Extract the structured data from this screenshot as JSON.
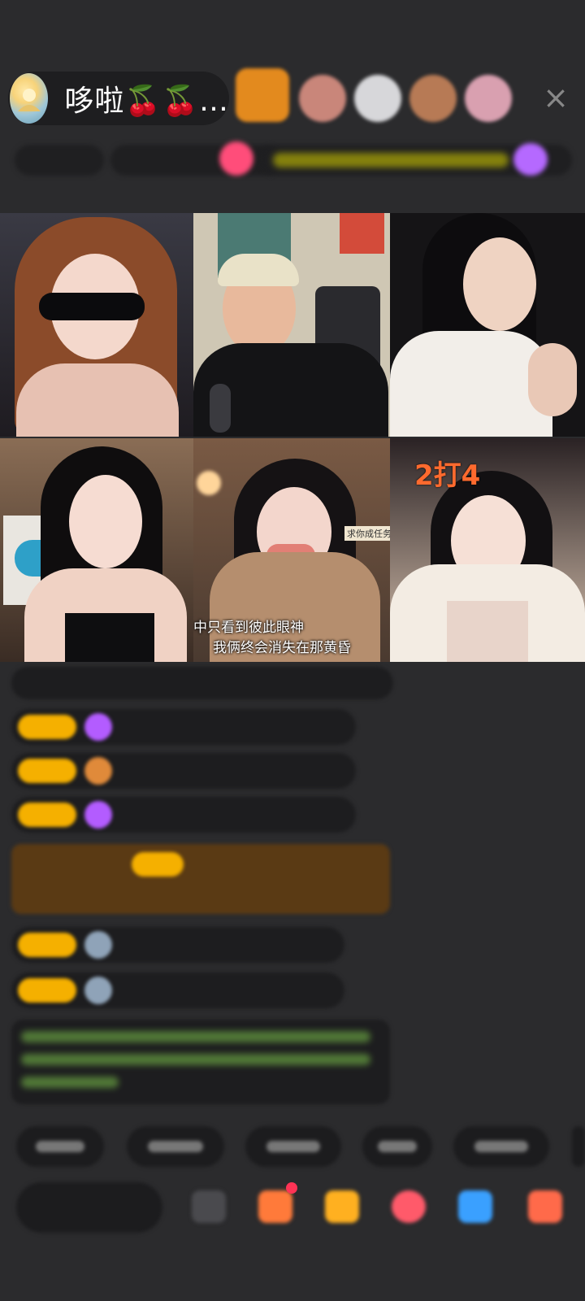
{
  "host": {
    "name": "哆啦🍒🍒…",
    "avatar_icon": "host-avatar-icon"
  },
  "viewers": [
    "viewer-avatar-1",
    "viewer-avatar-2",
    "viewer-avatar-3",
    "viewer-avatar-4",
    "viewer-avatar-5"
  ],
  "close_icon": "×",
  "videos": {
    "cell5_subtitle_1": "中只看到彼此眼神",
    "cell5_subtitle_2": "我俩终会消失在那黄昏",
    "cell5_tag": "求你成任务?",
    "cell6_badge": "2打4"
  },
  "colors": {
    "background": "#2b2b2d",
    "badge_yellow": "#f5b000",
    "notice_green": "#7bc24a",
    "badge_orange": "#ff6a2e"
  }
}
